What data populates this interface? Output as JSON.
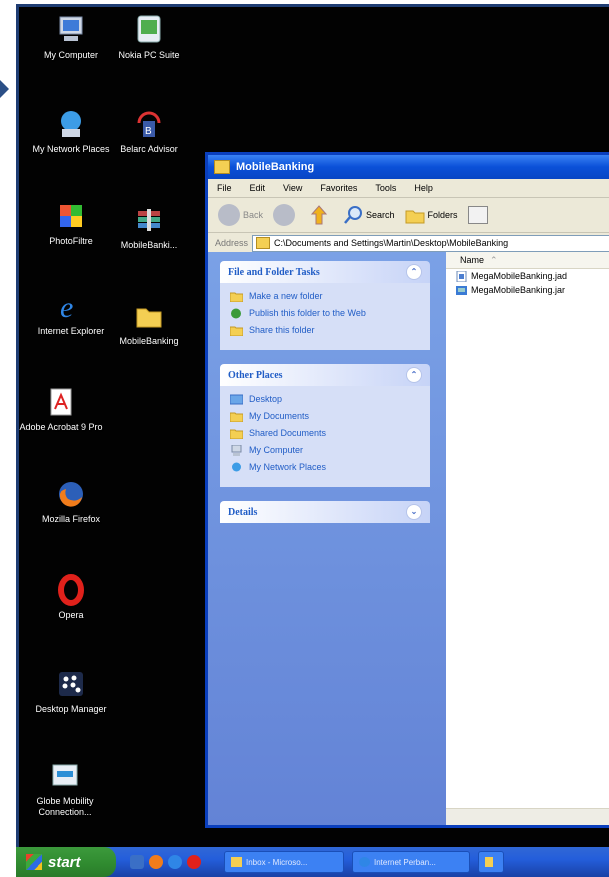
{
  "desktop": {
    "icons": [
      {
        "label": "My Computer"
      },
      {
        "label": "Nokia PC Suite"
      },
      {
        "label": "My Network Places"
      },
      {
        "label": "Belarc Advisor"
      },
      {
        "label": "PhotoFiltre"
      },
      {
        "label": "MobileBanki..."
      },
      {
        "label": "Internet Explorer"
      },
      {
        "label": "MobileBanking"
      },
      {
        "label": "Adobe Acrobat 9 Pro"
      },
      {
        "label": "Mozilla Firefox"
      },
      {
        "label": "Opera"
      },
      {
        "label": "Desktop Manager"
      },
      {
        "label": "Globe Mobility Connection..."
      }
    ]
  },
  "window": {
    "title": "MobileBanking",
    "menu": [
      "File",
      "Edit",
      "View",
      "Favorites",
      "Tools",
      "Help"
    ],
    "toolbar": {
      "back": "Back",
      "search": "Search",
      "folders": "Folders"
    },
    "address_label": "Address",
    "address_value": "C:\\Documents and Settings\\Martin\\Desktop\\MobileBanking",
    "tasks": {
      "file_folder_title": "File and Folder Tasks",
      "file_folder_items": [
        "Make a new folder",
        "Publish this folder to the Web",
        "Share this folder"
      ],
      "other_places_title": "Other Places",
      "other_places_items": [
        "Desktop",
        "My Documents",
        "Shared Documents",
        "My Computer",
        "My Network Places"
      ],
      "details_title": "Details"
    },
    "files": {
      "column_name": "Name",
      "rows": [
        "MegaMobileBanking.jad",
        "MegaMobileBanking.jar"
      ]
    }
  },
  "taskbar": {
    "start_label": "start",
    "buttons": [
      "Inbox - Microso...",
      "Internet Perban..."
    ]
  }
}
